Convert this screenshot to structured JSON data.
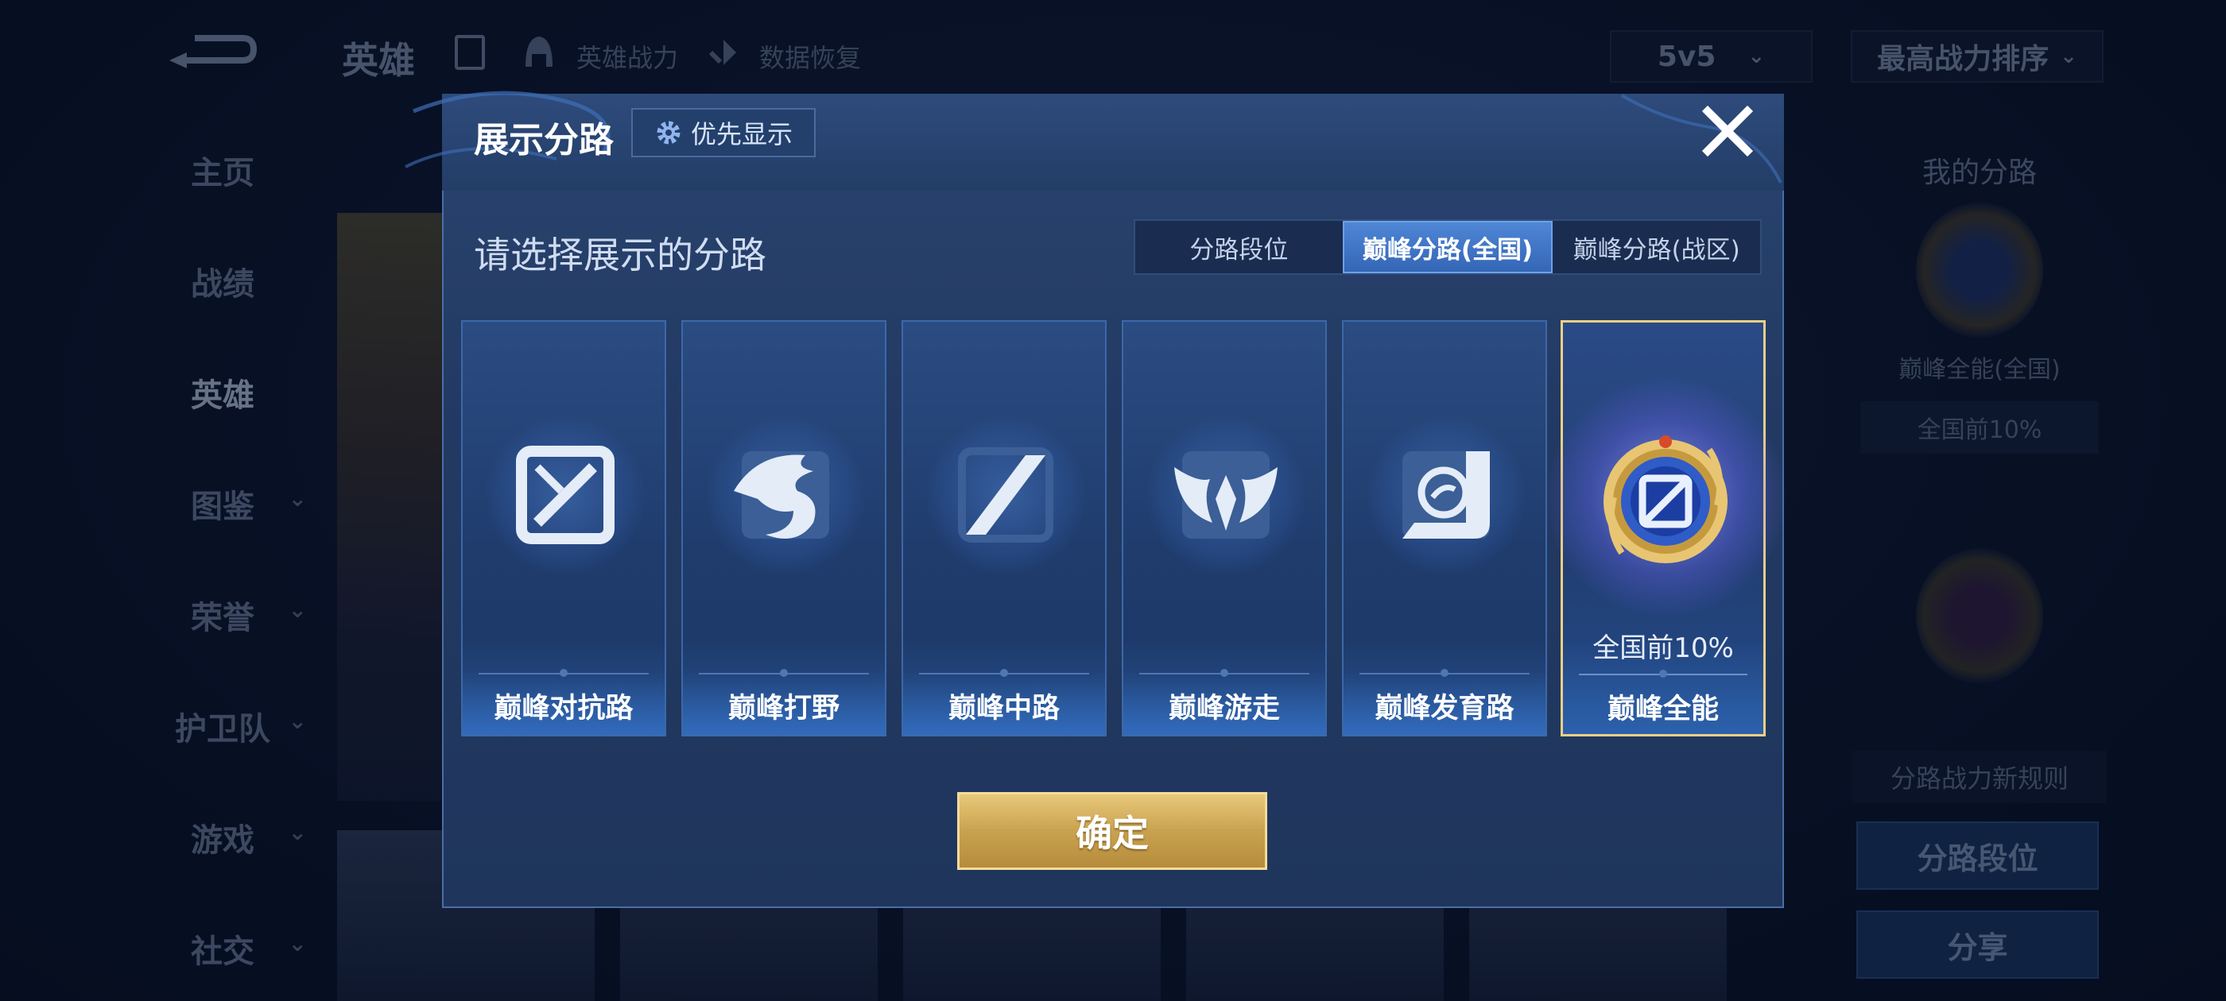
{
  "header": {
    "title": "英雄",
    "links": [
      "英雄战力",
      "数据恢复"
    ],
    "mode_select": "5v5",
    "sort_select": "最高战力排序"
  },
  "sidebar": {
    "items": [
      {
        "label": "主页",
        "has_chevron": false
      },
      {
        "label": "战绩",
        "has_chevron": false
      },
      {
        "label": "英雄",
        "has_chevron": false,
        "active": true
      },
      {
        "label": "图鉴",
        "has_chevron": true
      },
      {
        "label": "荣誉",
        "has_chevron": true
      },
      {
        "label": "护卫队",
        "has_chevron": true
      },
      {
        "label": "游戏",
        "has_chevron": true
      },
      {
        "label": "社交",
        "has_chevron": true
      }
    ]
  },
  "right_panel": {
    "title": "我的分路",
    "badge_label": "巅峰全能(全国)",
    "rank_pill": "全国前10%",
    "rule_text": "分路战力新规则",
    "lane_rank_button": "分路段位",
    "share_button": "分享"
  },
  "modal": {
    "title": "展示分路",
    "priority_button": "优先显示",
    "prompt": "请选择展示的分路",
    "tabs": [
      {
        "label": "分路段位",
        "active": false
      },
      {
        "label": "巅峰分路(全国)",
        "active": true
      },
      {
        "label": "巅峰分路(战区)",
        "active": false
      }
    ],
    "lanes": [
      {
        "label": "巅峰对抗路",
        "icon": "clash-lane-icon",
        "selected": false
      },
      {
        "label": "巅峰打野",
        "icon": "jungle-dragon-icon",
        "selected": false
      },
      {
        "label": "巅峰中路",
        "icon": "mid-lane-icon",
        "selected": false
      },
      {
        "label": "巅峰游走",
        "icon": "roam-wings-icon",
        "selected": false
      },
      {
        "label": "巅峰发育路",
        "icon": "farm-lane-icon",
        "selected": false
      },
      {
        "label": "巅峰全能",
        "icon": "all-round-emblem-icon",
        "selected": true,
        "rank": "全国前10%"
      }
    ],
    "confirm_button": "确定"
  },
  "colors": {
    "accent_gold": "#f0cf86",
    "tab_active": "#3f76c8",
    "modal_bg": "#223a63"
  }
}
